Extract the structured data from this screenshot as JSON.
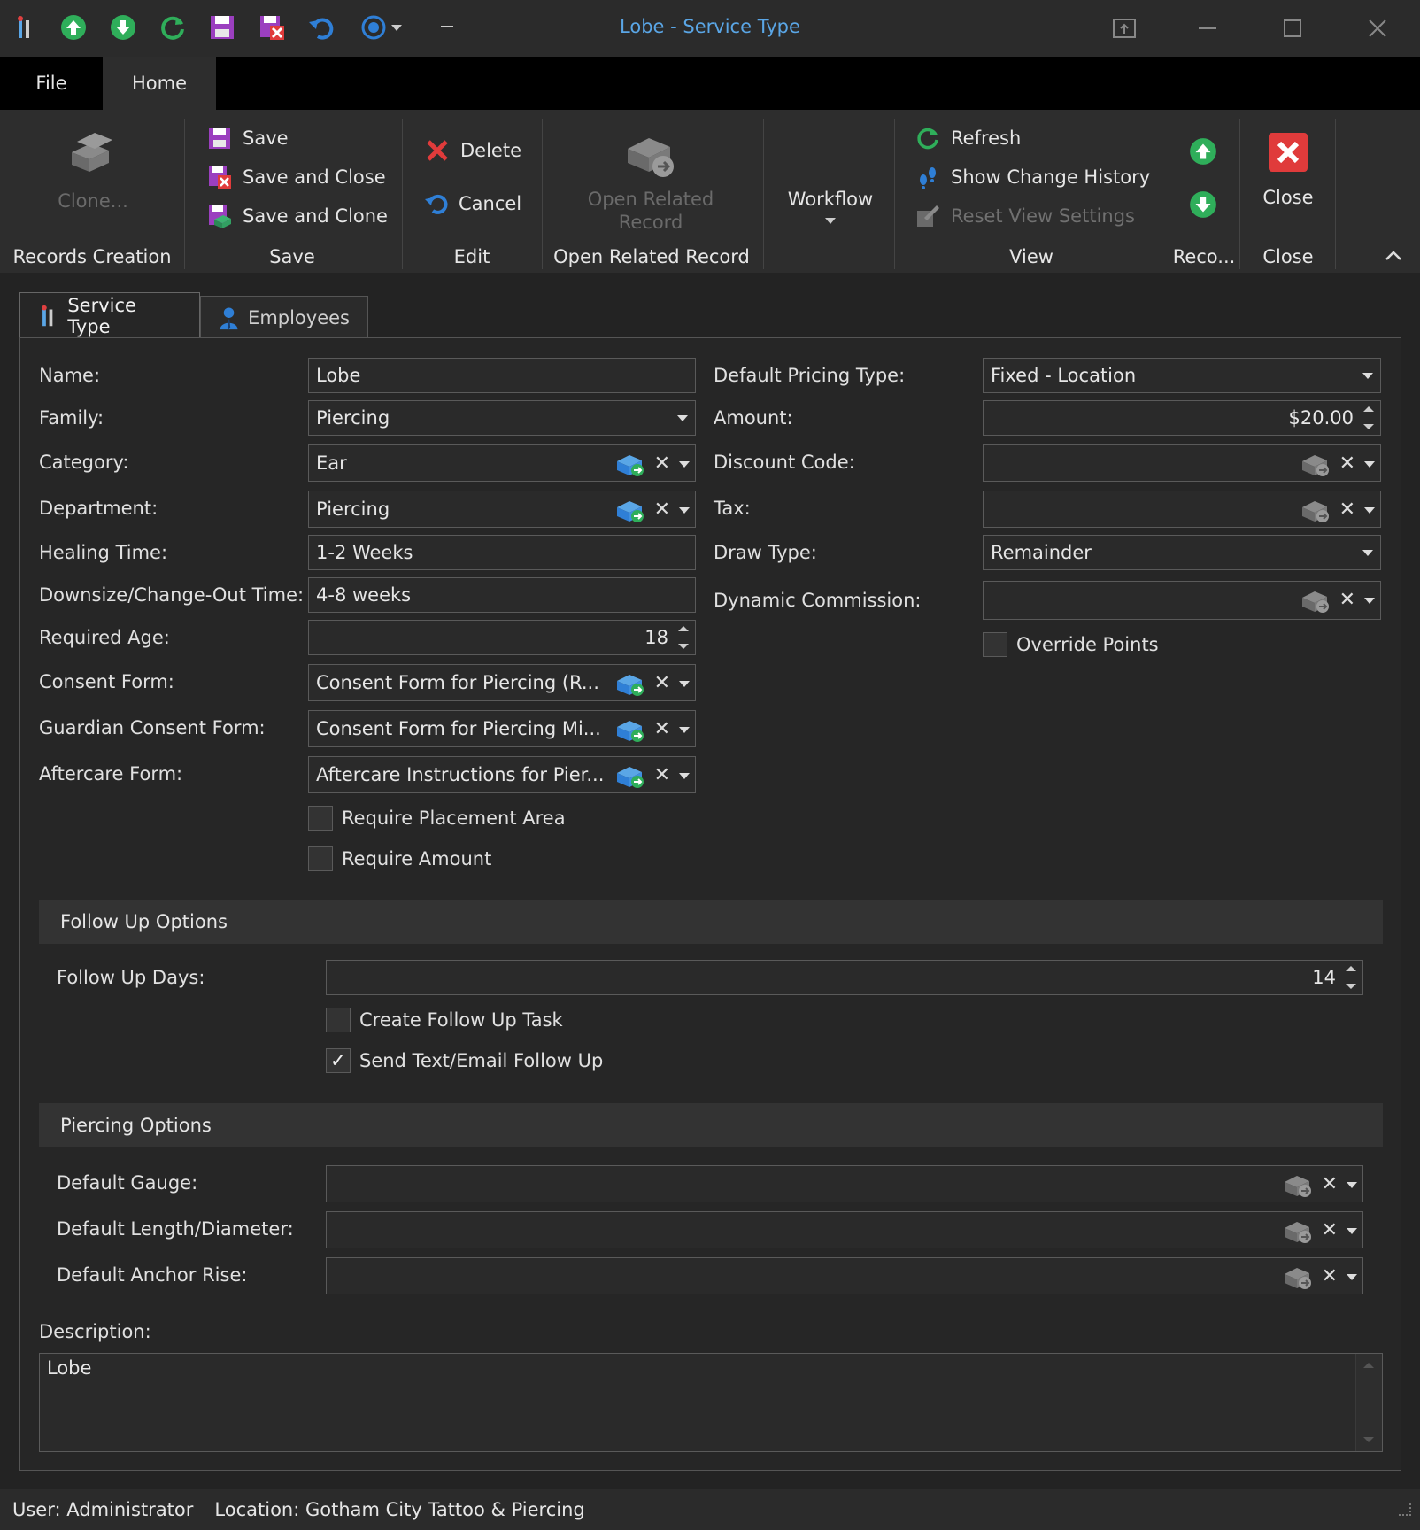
{
  "window": {
    "title": "Lobe - Service Type"
  },
  "quick_access": [
    "app-icon",
    "up-arrow-icon",
    "down-arrow-icon",
    "refresh-icon",
    "save-icon",
    "save-close-icon",
    "undo-icon",
    "workflow-icon",
    "customize-icon"
  ],
  "ribbon_tabs": {
    "file": "File",
    "home": "Home"
  },
  "ribbon": {
    "clone": "Clone...",
    "records_creation": "Records Creation",
    "save": "Save",
    "save_and_close": "Save and Close",
    "save_and_clone": "Save and Clone",
    "save_group": "Save",
    "delete": "Delete",
    "cancel": "Cancel",
    "edit_group": "Edit",
    "open_related_record_1": "Open Related",
    "open_related_record_2": "Record",
    "open_related_group": "Open Related Record",
    "workflow": "Workflow",
    "refresh": "Refresh",
    "show_change_history": "Show Change History",
    "reset_view_settings": "Reset View Settings",
    "view_group": "View",
    "reco_group": "Reco...",
    "close": "Close",
    "close_group": "Close"
  },
  "form_tabs": {
    "service_type": "Service Type",
    "employees": "Employees"
  },
  "form": {
    "name_label": "Name:",
    "name": "Lobe",
    "family_label": "Family:",
    "family": "Piercing",
    "category_label": "Category:",
    "category": "Ear",
    "department_label": "Department:",
    "department": "Piercing",
    "healing_label": "Healing Time:",
    "healing": "1-2 Weeks",
    "downsize_label": "Downsize/Change-Out Time:",
    "downsize": "4-8 weeks",
    "age_label": "Required Age:",
    "age": "18",
    "consent_label": "Consent Form:",
    "consent": "Consent Form for Piercing (R...",
    "guardian_label": "Guardian Consent Form:",
    "guardian": "Consent Form for Piercing Mi...",
    "aftercare_label": "Aftercare Form:",
    "aftercare": "Aftercare Instructions for Pier...",
    "require_placement": "Require Placement Area",
    "require_amount": "Require Amount",
    "pricing_label": "Default Pricing Type:",
    "pricing": "Fixed - Location",
    "amount_label": "Amount:",
    "amount": "$20.00",
    "discount_label": "Discount Code:",
    "tax_label": "Tax:",
    "draw_label": "Draw Type:",
    "draw": "Remainder",
    "commission_label": "Dynamic Commission:",
    "override_points": "Override Points"
  },
  "follow_up": {
    "section": "Follow Up Options",
    "days_label": "Follow Up Days:",
    "days": "14",
    "create_task": "Create Follow Up Task",
    "send_text": "Send Text/Email Follow Up",
    "send_text_checked": true
  },
  "piercing": {
    "section": "Piercing Options",
    "gauge_label": "Default Gauge:",
    "length_label": "Default Length/Diameter:",
    "anchor_label": "Default Anchor Rise:"
  },
  "description": {
    "label": "Description:",
    "value": "Lobe"
  },
  "status": {
    "user": "User: Administrator",
    "location": "Location: Gotham City Tattoo & Piercing"
  },
  "colors": {
    "accent": "#5aa6e6",
    "background": "#232323",
    "ribbon": "#2d2d2d",
    "close_red": "#e03b3b",
    "green": "#3cb371"
  }
}
